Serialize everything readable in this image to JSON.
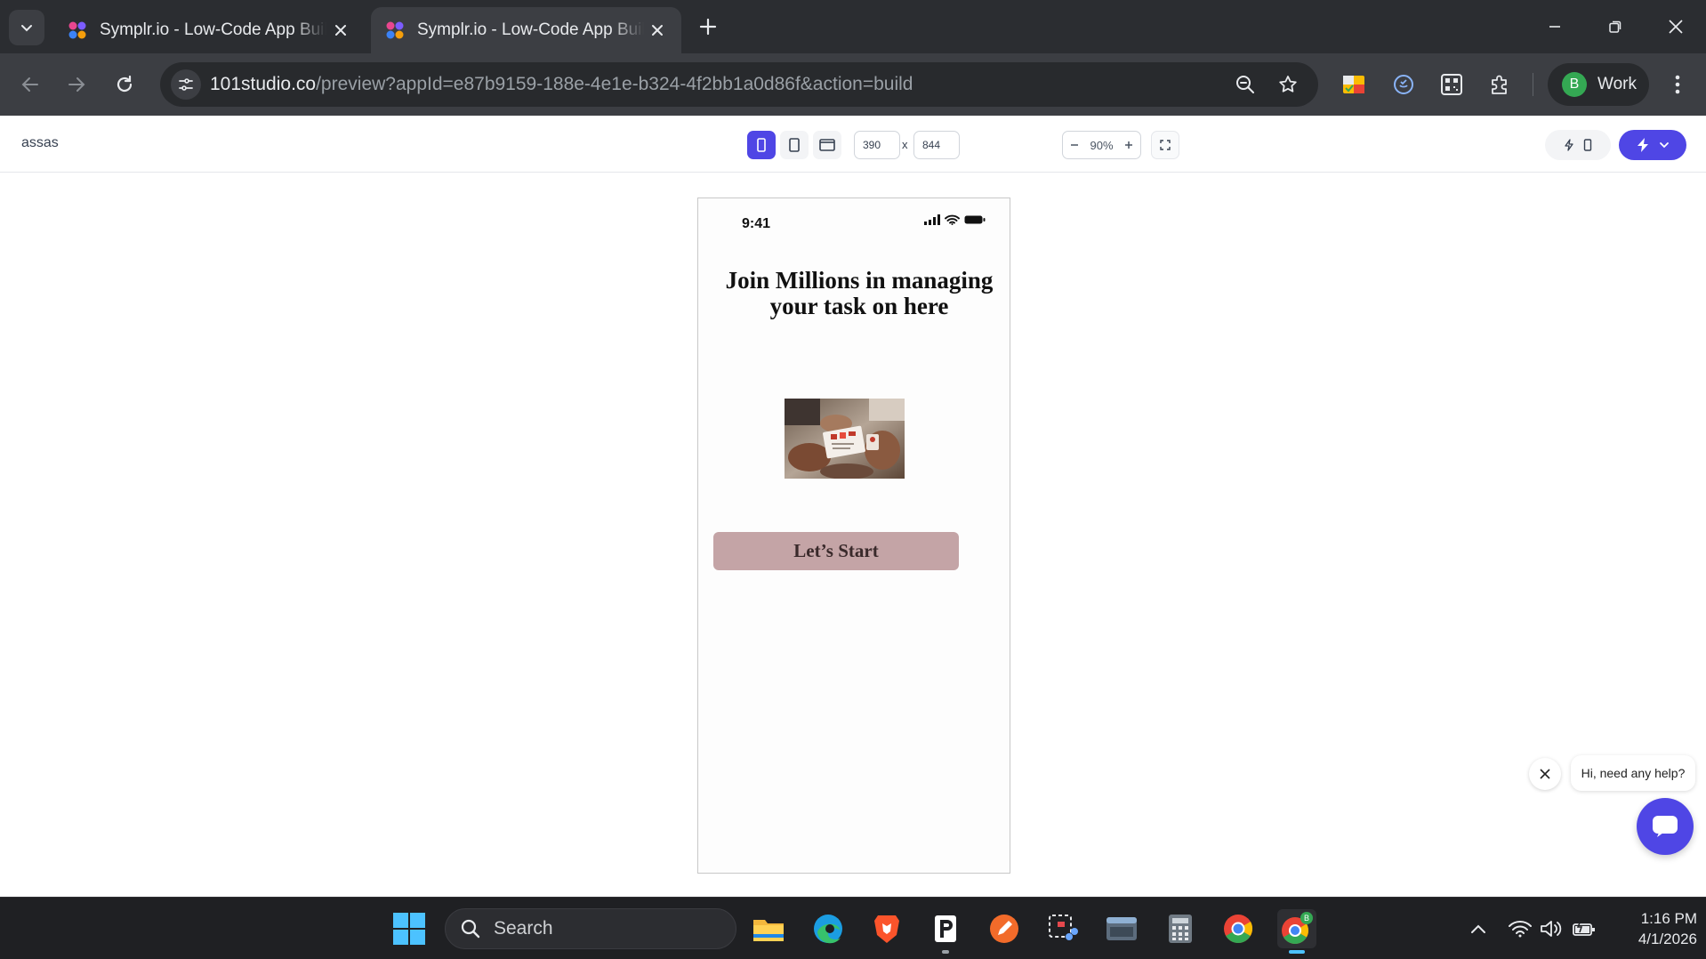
{
  "browser": {
    "tabs": [
      {
        "title": "Symplr.io - Low-Code App Builder",
        "active": false
      },
      {
        "title": "Symplr.io - Low-Code App Builder",
        "active": true
      }
    ],
    "url_host": "101studio.co",
    "url_path": "/preview?appId=e87b9159-188e-4e1e-b324-4f2bb1a0d86f&action=build",
    "profile_initial": "B",
    "profile_name": "Work"
  },
  "app": {
    "project_name": "assas",
    "viewport_width": "390",
    "viewport_height": "844",
    "dimension_separator": "x",
    "zoom_level": "90%",
    "accent_color": "#4f46e5"
  },
  "preview": {
    "status_time": "9:41",
    "headline": "Join Millions in managing your task on here",
    "cta_label": "Let’s Start",
    "cta_color": "#c4a4a6"
  },
  "help_widget": {
    "message": "Hi, need any help?"
  },
  "taskbar": {
    "search_label": "Search",
    "time": "1:16 PM",
    "date": "4/1/2026"
  }
}
